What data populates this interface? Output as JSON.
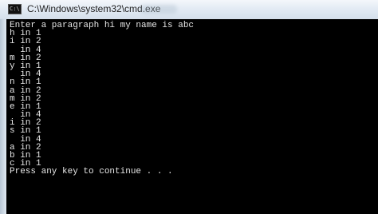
{
  "window": {
    "title": "C:\\Windows\\system32\\cmd.exe",
    "icon": "cmd-console-icon",
    "icon_glyph": "C:\\"
  },
  "console": {
    "lines": [
      "Enter a paragraph hi my name is abc",
      "h in 1",
      "i in 2",
      "  in 4",
      "m in 2",
      "y in 1",
      "  in 4",
      "n in 1",
      "a in 2",
      "m in 2",
      "e in 1",
      "  in 4",
      "i in 2",
      "s in 1",
      "  in 4",
      "a in 2",
      "b in 1",
      "c in 1",
      "Press any key to continue . . ."
    ]
  },
  "colors": {
    "console_background": "#000000",
    "console_text": "#e6e6e6",
    "titlebar": "#dfe8f1"
  }
}
